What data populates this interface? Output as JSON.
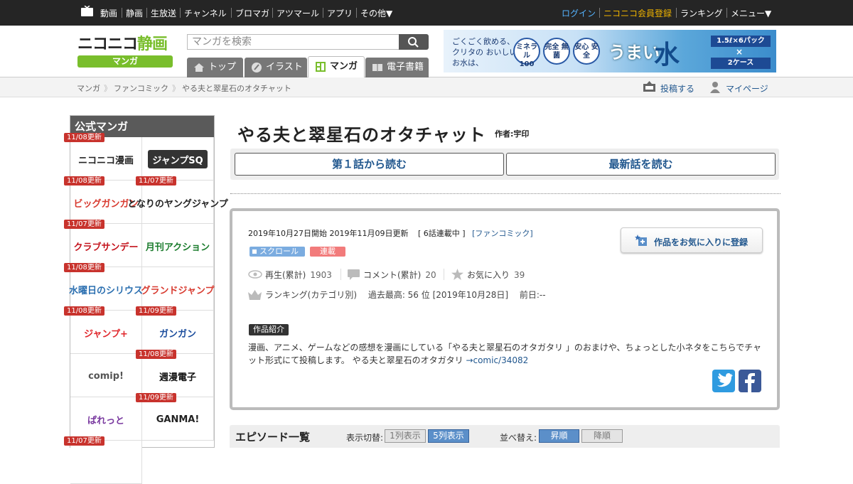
{
  "topnav": {
    "items": [
      "動画",
      "静画",
      "生放送",
      "チャンネル",
      "ブロマガ",
      "アツマール",
      "アプリ",
      "その他▼"
    ],
    "login": "ログイン",
    "register": "ニコニコ会員登録",
    "ranking": "ランキング",
    "menu": "メニュー▼"
  },
  "logo": {
    "main_a": "ニコニコ",
    "main_b": "静画",
    "sub": "マンガ"
  },
  "search": {
    "placeholder": "マンガを検索"
  },
  "tabs": [
    {
      "label": "トップ"
    },
    {
      "label": "イラスト"
    },
    {
      "label": "マンガ"
    },
    {
      "label": "電子書籍"
    }
  ],
  "ad": {
    "text1": "ごくごく飲める、クリタの おいしいお水は、",
    "circle1": "ミネラル 100",
    "circle2": "完全 無菌",
    "circle3": "安心 安全",
    "umai": "うまい",
    "mizu": "水",
    "pack": "1.5ℓ×6パック",
    "x": "×",
    "case": "2ケース"
  },
  "breadcrumb": [
    "マンガ",
    "ファンコミック",
    "やる夫と翠星石のオタチャット"
  ],
  "header_links": {
    "post": "投稿する",
    "mypage": "マイページ"
  },
  "sidebar": {
    "title": "公式マンガ",
    "items": [
      {
        "badge": "11/08更新",
        "name": "ニコニコ漫画"
      },
      {
        "badge": "",
        "name": "ジャンプSQ"
      },
      {
        "badge": "11/08更新",
        "name": "ビッグガンガン"
      },
      {
        "badge": "11/07更新",
        "name": "となりのヤングジャンプ"
      },
      {
        "badge": "11/07更新",
        "name": "クラブサンデー"
      },
      {
        "badge": "",
        "name": "月刊アクション"
      },
      {
        "badge": "11/08更新",
        "name": "水曜日のシリウス"
      },
      {
        "badge": "",
        "name": "グランドジャンプ"
      },
      {
        "badge": "11/08更新",
        "name": "ジャンプ+"
      },
      {
        "badge": "11/09更新",
        "name": "ガンガン"
      },
      {
        "badge": "",
        "name": "comip!"
      },
      {
        "badge": "11/08更新",
        "name": "週漫電子"
      },
      {
        "badge": "",
        "name": "ぱれっと"
      },
      {
        "badge": "11/09更新",
        "name": "GANMA!"
      },
      {
        "badge": "11/07更新",
        "name": ""
      }
    ]
  },
  "work": {
    "title": "やる夫と翠星石のオタチャット",
    "author": "作者:宇印",
    "read_first": "第１話から読む",
    "read_latest": "最新話を読む",
    "meta_dates": "2019年10月27日開始 2019年11月09日更新",
    "meta_count": "[ 6話連載中 ]",
    "meta_genre": "[ファンコミック]",
    "fav_button": "作品をお気に入りに登録",
    "tag_scroll": "スクロール",
    "tag_serial": "連載",
    "views_label": "再生(累計)",
    "views": "1903",
    "comments_label": "コメント(累計)",
    "comments": "20",
    "favs_label": "お気に入り",
    "favs": "39",
    "ranking": "ランキング(カテゴリ別)　 過去最高: 56 位 [2019年10月28日]　 前日:--",
    "intro_label": "作品紹介",
    "description": "漫画、アニメ、ゲームなどの感想を漫画にしている「やる夫と翠星石のオタガタリ 」のおまけや、ちょっとした小ネタをこちらでチャット形式にて投稿します。 やる夫と翠星石のオタガタリ ",
    "desc_link": "→comic/34082"
  },
  "episodes": {
    "title": "エピソード一覧",
    "view_label": "表示切替:",
    "view1": "1列表示",
    "view5": "5列表示",
    "sort_label": "並べ替え:",
    "asc": "昇順",
    "desc": "降順"
  }
}
